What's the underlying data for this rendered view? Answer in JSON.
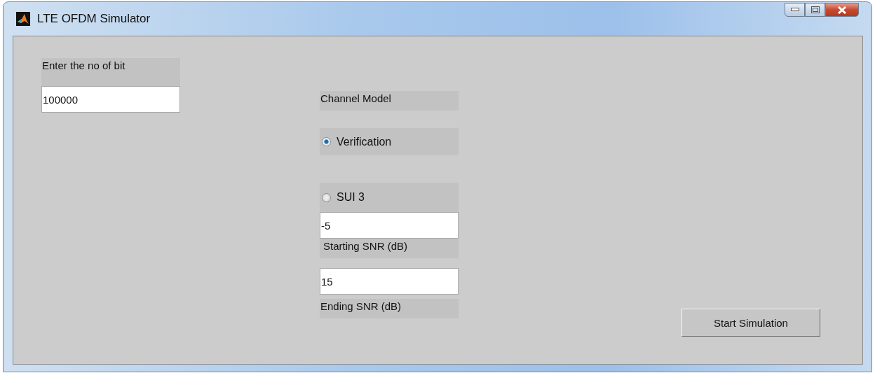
{
  "window": {
    "title": "LTE OFDM Simulator"
  },
  "bits": {
    "label": "Enter the no of bit",
    "value": "100000"
  },
  "channel_model": {
    "label": "Channel Model",
    "options": [
      {
        "label": "Verification",
        "selected": true
      },
      {
        "label": "SUI 3",
        "selected": false
      }
    ]
  },
  "starting_snr": {
    "value": "-5",
    "label": "Starting SNR (dB)"
  },
  "ending_snr": {
    "value": "15",
    "label": "Ending SNR (dB)"
  },
  "start_button": {
    "label": "Start Simulation"
  }
}
